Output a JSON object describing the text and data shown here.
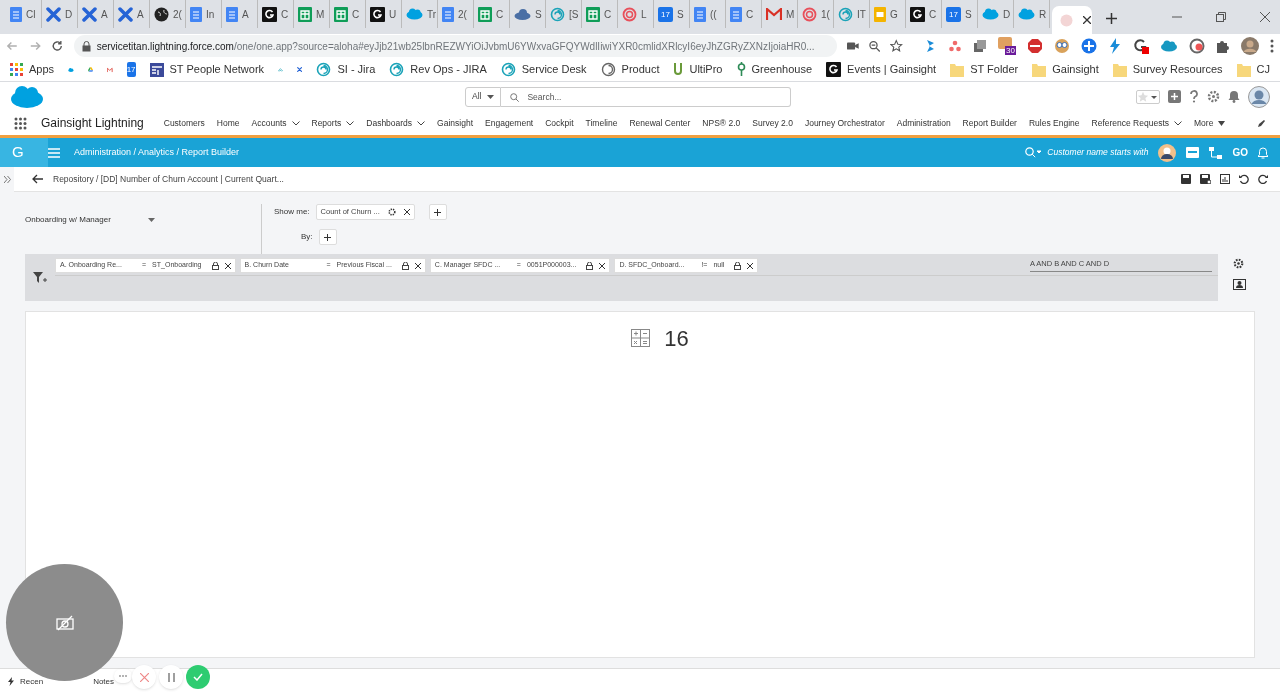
{
  "browser": {
    "tabs": [
      {
        "kind": "doc",
        "title": "Cl",
        "selected": false
      },
      {
        "kind": "jira",
        "title": "D",
        "selected": false
      },
      {
        "kind": "jira",
        "title": "A",
        "selected": false
      },
      {
        "kind": "jira",
        "title": "A",
        "selected": false
      },
      {
        "kind": "globe",
        "title": "2(",
        "selected": false
      },
      {
        "kind": "doc",
        "title": "In",
        "selected": false
      },
      {
        "kind": "doc",
        "title": "A",
        "selected": false
      },
      {
        "kind": "gainsight",
        "title": "C",
        "selected": false
      },
      {
        "kind": "sheets",
        "title": "M",
        "selected": false
      },
      {
        "kind": "sheets",
        "title": "C",
        "selected": false
      },
      {
        "kind": "gainsight",
        "title": "U",
        "selected": false
      },
      {
        "kind": "salesforce",
        "title": "Tr",
        "selected": false
      },
      {
        "kind": "doc",
        "title": "2(",
        "selected": false
      },
      {
        "kind": "sheets",
        "title": "C",
        "selected": false
      },
      {
        "kind": "cloud",
        "title": "S",
        "selected": false
      },
      {
        "kind": "spiral",
        "title": "[S",
        "selected": false
      },
      {
        "kind": "sheets",
        "title": "C",
        "selected": false
      },
      {
        "kind": "ring",
        "title": "L",
        "selected": false
      },
      {
        "kind": "calendar",
        "badge": "17",
        "title": "S",
        "selected": false
      },
      {
        "kind": "doc",
        "title": "((",
        "selected": false
      },
      {
        "kind": "doc",
        "title": "C",
        "selected": false
      },
      {
        "kind": "gmail",
        "title": "M",
        "selected": false
      },
      {
        "kind": "ring",
        "title": "1(",
        "selected": false
      },
      {
        "kind": "spiral",
        "title": "IT",
        "selected": false
      },
      {
        "kind": "slides",
        "title": "G",
        "selected": false
      },
      {
        "kind": "gainsight",
        "title": "C",
        "selected": false
      },
      {
        "kind": "calendar",
        "badge": "17",
        "title": "S",
        "selected": false
      },
      {
        "kind": "salesforce",
        "title": "D",
        "selected": false
      },
      {
        "kind": "salesforce",
        "title": "R",
        "selected": false
      },
      {
        "kind": "blank",
        "selected": true
      }
    ],
    "url_host": "servicetitan.lightning.force.com",
    "url_path": "/one/one.app?source=aloha#eyJjb21wb25lbnREZWYiOiJvbmU6YWxvaGFQYWdlIiwiYXR0cmlidXRlcyI6eyJhZGRyZXNzIjoiaHR0...",
    "extension_badge": "30",
    "bookmarks": [
      {
        "kind": "apps",
        "label": "Apps"
      },
      {
        "kind": "salesforce"
      },
      {
        "kind": "drive"
      },
      {
        "kind": "gmail"
      },
      {
        "kind": "calendar",
        "badge": "17"
      },
      {
        "kind": "grid",
        "label": "ST People Network"
      },
      {
        "kind": "arrow"
      },
      {
        "kind": "jira"
      },
      {
        "kind": "spiral",
        "label": "SI - Jira"
      },
      {
        "kind": "spiral",
        "label": "Rev Ops - JIRA"
      },
      {
        "kind": "spiral",
        "label": "Service Desk"
      },
      {
        "kind": "spiral-grey",
        "label": "Product"
      },
      {
        "kind": "ultipro",
        "label": "UltiPro"
      },
      {
        "kind": "greenhouse",
        "label": "Greenhouse"
      },
      {
        "kind": "gainsight",
        "label": "Events | Gainsight"
      },
      {
        "kind": "folder",
        "label": "ST Folder"
      },
      {
        "kind": "folder",
        "label": "Gainsight"
      },
      {
        "kind": "folder",
        "label": "Survey Resources"
      },
      {
        "kind": "folder",
        "label": "CJ"
      }
    ]
  },
  "salesforce": {
    "search_scope": "All",
    "search_placeholder": "Search...",
    "app_name": "Gainsight Lightning",
    "nav": [
      {
        "label": "Customers",
        "dropdown": false
      },
      {
        "label": "Home",
        "dropdown": false
      },
      {
        "label": "Accounts",
        "dropdown": true
      },
      {
        "label": "Reports",
        "dropdown": true
      },
      {
        "label": "Dashboards",
        "dropdown": true
      },
      {
        "label": "Gainsight",
        "dropdown": false
      },
      {
        "label": "Engagement",
        "dropdown": false
      },
      {
        "label": "Cockpit",
        "dropdown": false
      },
      {
        "label": "Timeline",
        "dropdown": false
      },
      {
        "label": "Renewal Center",
        "dropdown": false
      },
      {
        "label": "NPS® 2.0",
        "dropdown": false
      },
      {
        "label": "Survey 2.0",
        "dropdown": false
      },
      {
        "label": "Journey Orchestrator",
        "dropdown": false
      },
      {
        "label": "Administration",
        "dropdown": false
      },
      {
        "label": "Report Builder",
        "dropdown": false
      },
      {
        "label": "Rules Engine",
        "dropdown": false
      },
      {
        "label": "Reference Requests",
        "dropdown": true
      },
      {
        "label": "More",
        "dropdown": true
      }
    ]
  },
  "gainsight": {
    "logo": "G",
    "breadcrumb": "Administration / Analytics / Report Builder",
    "search_hint": "Customer name starts with",
    "go_label": "GO",
    "report_path": "Repository / [DD] Number of Churn Account | Current Quart...",
    "object": "Onboarding w/ Manager",
    "show_me_label": "Show me:",
    "show_me_chip": "Count of Churn ...",
    "by_label": "By:",
    "filters": [
      {
        "label": "A. Onboarding Re...",
        "operator": "=",
        "value": "ST_Onboarding"
      },
      {
        "label": "B. Churn Date",
        "operator": "=",
        "value": "Previous Fiscal ..."
      },
      {
        "label": "C. Manager SFDC ...",
        "operator": "=",
        "value": "0051P000003..."
      },
      {
        "label": "D. SFDC_Onboard...",
        "operator": "!=",
        "value": "null"
      }
    ],
    "filter_logic": "A AND B AND C AND D",
    "result": "16"
  },
  "footer": {
    "items": [
      "Recen",
      "Notes"
    ]
  }
}
